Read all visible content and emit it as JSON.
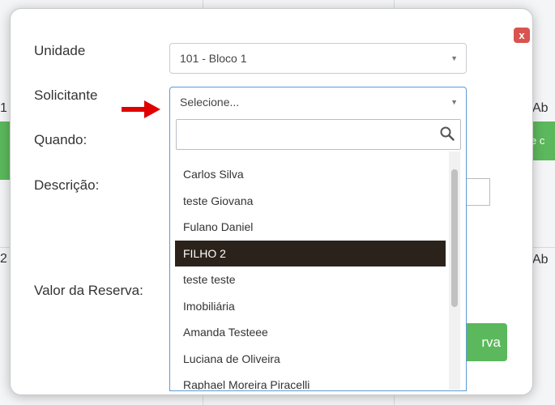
{
  "background": {
    "left_numbers": [
      "1",
      "2"
    ],
    "right_labels": [
      "Ab",
      "Ab"
    ],
    "green_snippet": "e c"
  },
  "form": {
    "unit_label": "Unidade",
    "unit_value": "101 - Bloco 1",
    "requester_label": "Solicitante",
    "requester_placeholder": "Selecione...",
    "when_label": "Quando:",
    "description_label": "Descrição:",
    "price_label": "Valor da Reserva:",
    "reserve_button_partial": "rva"
  },
  "dropdown": {
    "search_value": "",
    "options": [
      {
        "label": "",
        "partial": true
      },
      {
        "label": "Carlos Silva"
      },
      {
        "label": "teste Giovana"
      },
      {
        "label": "Fulano Daniel"
      },
      {
        "label": "FILHO 2",
        "highlighted": true
      },
      {
        "label": "teste teste"
      },
      {
        "label": "Imobiliária"
      },
      {
        "label": "Amanda Testeee"
      },
      {
        "label": "Luciana de Oliveira"
      },
      {
        "label": "Raphael Moreira Piracelli"
      }
    ]
  },
  "colors": {
    "close": "#d9534f",
    "success": "#5cb85c",
    "focus_border": "#5b9bd5",
    "highlight": "#2b231b",
    "arrow": "#e00000"
  },
  "icons": {
    "close": "close-icon",
    "search": "search-icon",
    "dropdown_arrow": "chevron-down-icon",
    "pointer": "red-arrow-icon"
  }
}
